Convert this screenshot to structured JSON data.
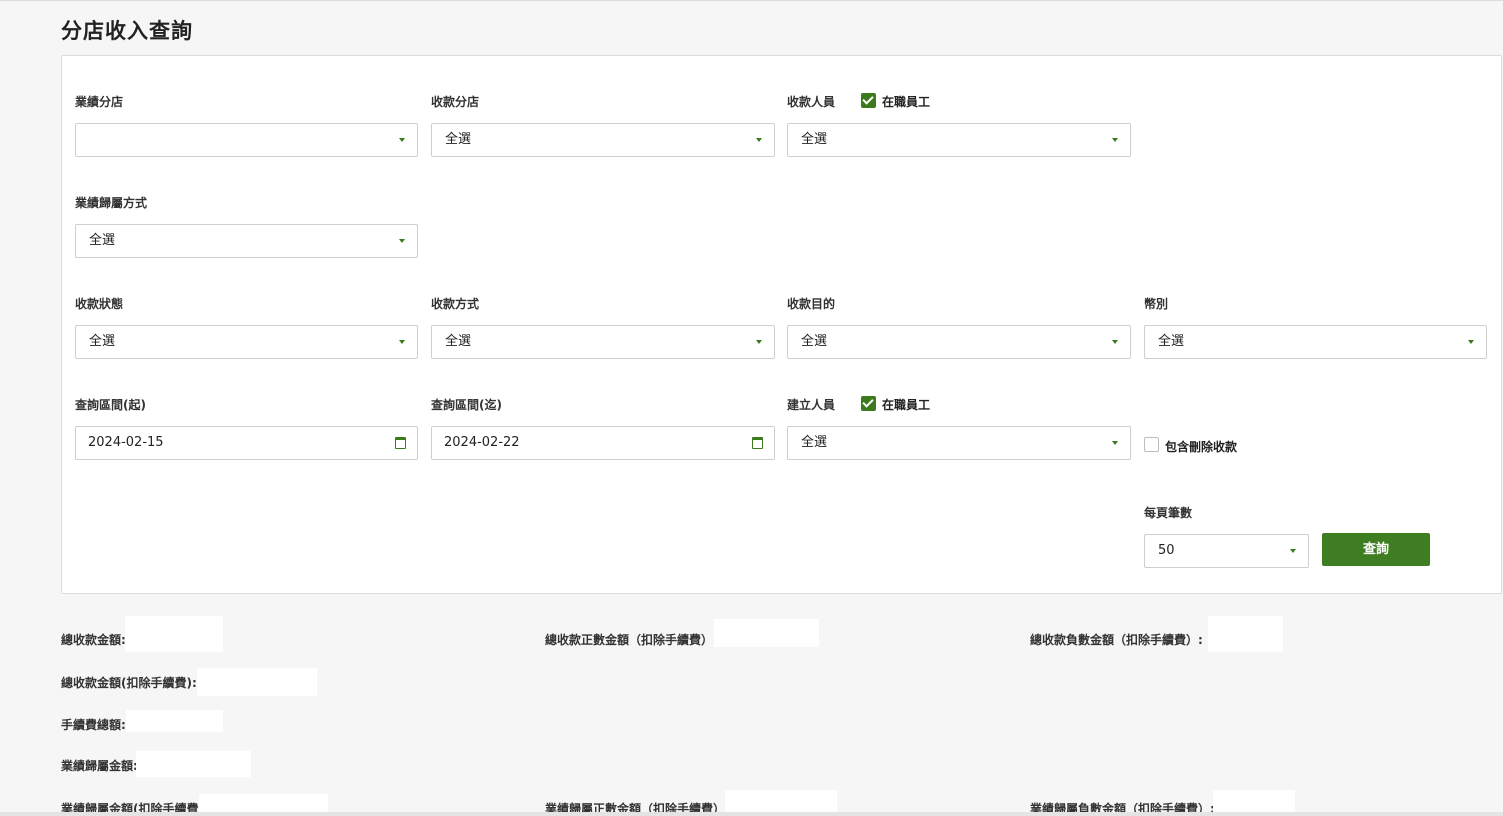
{
  "page_title": "分店收入查詢",
  "filters": {
    "perf_branch": {
      "label": "業績分店",
      "value": ""
    },
    "receive_branch": {
      "label": "收款分店",
      "value": "全選"
    },
    "receiver": {
      "label": "收款人員",
      "value": "全選",
      "checkbox_label": "在職員工",
      "checked": true
    },
    "attribution_method": {
      "label": "業績歸屬方式",
      "value": "全選"
    },
    "payment_status": {
      "label": "收款狀態",
      "value": "全選"
    },
    "payment_method": {
      "label": "收款方式",
      "value": "全選"
    },
    "payment_purpose": {
      "label": "收款目的",
      "value": "全選"
    },
    "currency": {
      "label": "幣別",
      "value": "全選"
    },
    "date_start": {
      "label": "查詢區間(起)",
      "value": "2024-02-15"
    },
    "date_end": {
      "label": "查詢區間(迄)",
      "value": "2024-02-22"
    },
    "creator": {
      "label": "建立人員",
      "value": "全選",
      "checkbox_label": "在職員工",
      "checked": true
    },
    "include_deleted": {
      "label": "包含刪除收款",
      "checked": false
    },
    "page_size": {
      "label": "每頁筆數",
      "value": "50"
    }
  },
  "query_button": "查詢",
  "summary": {
    "total_amount": "總收款金額:",
    "total_positive_net": "總收款正數金額（扣除手續費）",
    "total_negative_net": "總收款負數金額（扣除手續費）:",
    "total_amount_net": "總收款金額(扣除手續費):",
    "fee_total": "手續費總額:",
    "attribution_amount": "業績歸屬金額:",
    "attribution_amount_net": "業績歸屬金額(扣除手續費",
    "attribution_positive_net": "業績歸屬正數金額（扣除手續費）",
    "attribution_negative_net": "業績歸屬負數金額（扣除手續費）:"
  },
  "colors": {
    "accent": "#3f7d22",
    "background": "#f6f6f6"
  }
}
